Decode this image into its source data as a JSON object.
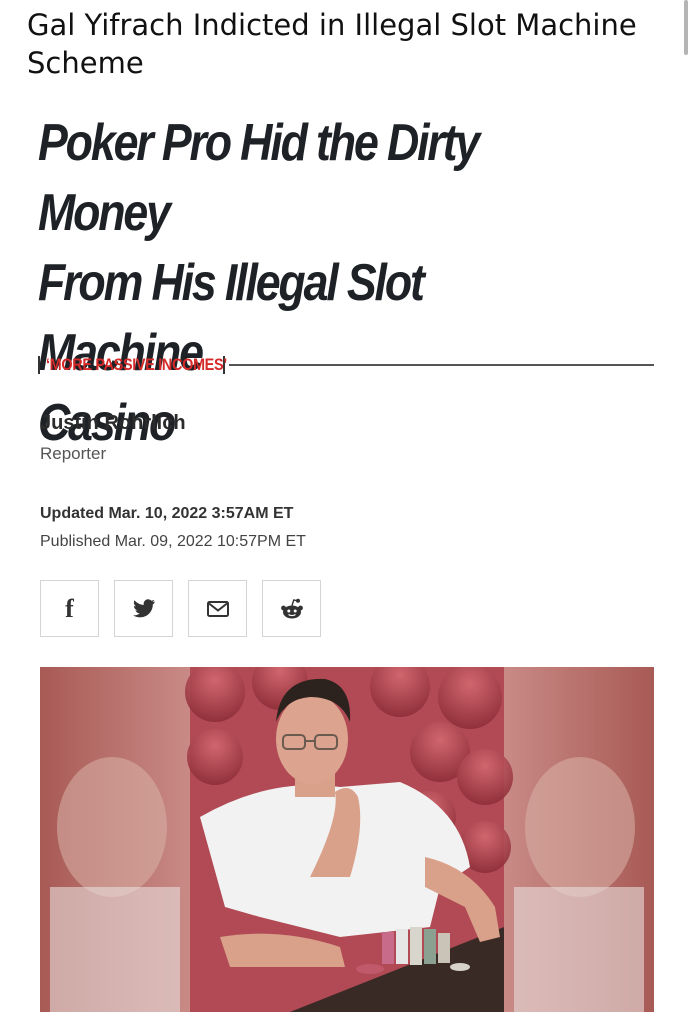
{
  "post": {
    "caption": "Gal Yifrach Indicted in Illegal Slot Machine Scheme"
  },
  "article": {
    "headline_line1": "Poker Pro Hid the Dirty Money",
    "headline_line2": "From His Illegal Slot Machine",
    "headline_line3": "Casino",
    "rubric": "‘MORE PASSIVE INCOMES’",
    "author_name": "Justin Rohrlich",
    "author_role": "Reporter",
    "updated": "Updated Mar. 10, 2022 3:57AM ET",
    "published": "Published Mar. 09, 2022 10:57PM ET"
  },
  "share": {
    "buttons": [
      {
        "icon": "facebook-icon",
        "glyph": "f"
      },
      {
        "icon": "twitter-icon"
      },
      {
        "icon": "email-icon"
      },
      {
        "icon": "reddit-icon"
      }
    ]
  },
  "photo": {
    "description_icon": "poker-player-photo"
  },
  "colors": {
    "rubric_red": "#d62a2a",
    "headline": "#1e2126",
    "share_border": "#d4d4d4"
  }
}
